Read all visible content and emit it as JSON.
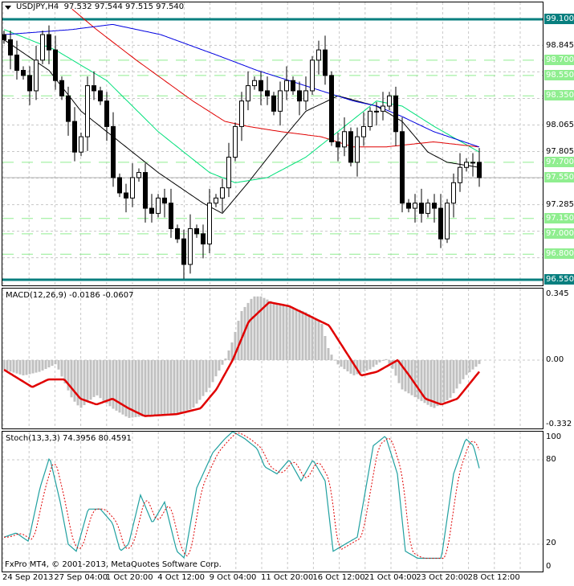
{
  "header": {
    "symbol": "USDJPY,H4",
    "ohlc": "97.532 97.544 97.515 97.540"
  },
  "macd_header": "MACD(12,26,9) -0.0186 -0.0607",
  "stoch_header": "Stoch(13,3,3) 74.3956 80.4591",
  "copyright": "FxPro MT4, © 2001-2013, MetaQuotes Software Corp.",
  "colors": {
    "teal": "#087f7f",
    "level_green": "#90ee90",
    "ma_fast": "#000000",
    "ma_green": "#00e07a",
    "ma_red": "#e00000",
    "ma_blue": "#0000e0",
    "macd_hist": "#c0c0c0",
    "macd_signal": "#e00000",
    "stoch_main": "#20a0a0",
    "stoch_signal": "#e00000"
  },
  "price_axis": {
    "grid_labels": [
      "98.845",
      "98.065",
      "97.805",
      "97.285"
    ],
    "teal_levels": [
      "99.100",
      "96.550"
    ],
    "green_levels": [
      "98.700",
      "98.550",
      "98.350",
      "97.700",
      "97.550",
      "97.150",
      "97.000",
      "96.800"
    ]
  },
  "macd_axis": [
    "0.345",
    "0.00",
    "-0.332"
  ],
  "stoch_axis": [
    "100",
    "80",
    "20",
    "0"
  ],
  "time_axis": [
    "24 Sep 2013",
    "27 Sep 04:00",
    "1 Oct 20:00",
    "4 Oct 12:00",
    "9 Oct 04:00",
    "11 Oct 20:00",
    "16 Oct 12:00",
    "21 Oct 04:00",
    "23 Oct 20:00",
    "28 Oct 12:00"
  ],
  "chart_data": {
    "type": "candlestick",
    "symbol": "USDJPY",
    "timeframe": "H4",
    "price_range": [
      96.505,
      99.13
    ],
    "closes": [
      98.9,
      98.75,
      98.6,
      98.55,
      98.4,
      98.7,
      98.95,
      98.8,
      98.5,
      98.35,
      98.1,
      97.8,
      97.95,
      98.45,
      98.4,
      98.3,
      98.05,
      97.55,
      97.4,
      97.35,
      97.55,
      97.6,
      97.25,
      97.2,
      97.35,
      97.3,
      97.05,
      96.95,
      96.7,
      97.05,
      97.0,
      96.9,
      97.3,
      97.35,
      97.45,
      97.75,
      98.05,
      98.3,
      98.45,
      98.5,
      98.4,
      98.35,
      98.2,
      98.4,
      98.5,
      98.4,
      98.3,
      98.4,
      98.7,
      98.8,
      98.55,
      97.9,
      97.85,
      98.0,
      97.7,
      97.95,
      98.05,
      98.2,
      98.2,
      98.25,
      98.35,
      98.0,
      97.3,
      97.25,
      97.3,
      97.2,
      97.3,
      97.25,
      96.95,
      97.3,
      97.5,
      97.65,
      97.7,
      97.7,
      97.55
    ],
    "moving_averages": {
      "black": [
        [
          0,
          98.9
        ],
        [
          7,
          98.6
        ],
        [
          12,
          98.2
        ],
        [
          18,
          97.9
        ],
        [
          24,
          97.6
        ],
        [
          31,
          97.3
        ],
        [
          34,
          97.2
        ],
        [
          38,
          97.5
        ],
        [
          43,
          97.9
        ],
        [
          47,
          98.2
        ],
        [
          52,
          98.35
        ],
        [
          58,
          98.25
        ],
        [
          62,
          98.1
        ],
        [
          66,
          97.8
        ],
        [
          69,
          97.7
        ],
        [
          74,
          97.65
        ]
      ],
      "green": [
        [
          0,
          99.0
        ],
        [
          8,
          98.8
        ],
        [
          16,
          98.5
        ],
        [
          24,
          98.0
        ],
        [
          32,
          97.6
        ],
        [
          36,
          97.5
        ],
        [
          41,
          97.55
        ],
        [
          47,
          97.75
        ],
        [
          52,
          98.0
        ],
        [
          58,
          98.3
        ],
        [
          62,
          98.25
        ],
        [
          67,
          98.05
        ],
        [
          74,
          97.8
        ]
      ],
      "red": [
        [
          10.6,
          99.2
        ],
        [
          14.4,
          99.0
        ],
        [
          20.6,
          98.7
        ],
        [
          29.4,
          98.3
        ],
        [
          34.4,
          98.1
        ],
        [
          38.1,
          98.05
        ],
        [
          43.1,
          98.0
        ],
        [
          49.4,
          97.95
        ],
        [
          54.4,
          97.85
        ],
        [
          59.4,
          97.85
        ],
        [
          66.9,
          97.9
        ],
        [
          74,
          97.85
        ]
      ],
      "blue": [
        [
          0,
          98.95
        ],
        [
          10.6,
          99.0
        ],
        [
          16.9,
          99.05
        ],
        [
          24.4,
          98.95
        ],
        [
          33.1,
          98.75
        ],
        [
          39.4,
          98.6
        ],
        [
          44.4,
          98.5
        ],
        [
          49.4,
          98.4
        ],
        [
          54.4,
          98.3
        ],
        [
          58.1,
          98.25
        ],
        [
          61.9,
          98.15
        ],
        [
          66.9,
          98.0
        ],
        [
          74,
          97.85
        ]
      ]
    },
    "levels": {
      "teal": [
        99.1,
        96.55
      ],
      "green": [
        98.7,
        98.55,
        98.35,
        97.7,
        97.55,
        97.15,
        97.0,
        96.8
      ],
      "grid": [
        98.845,
        98.585,
        98.325,
        98.065,
        97.805,
        97.545,
        97.285,
        97.025,
        96.765
      ]
    },
    "macd": {
      "range": [
        -0.332,
        0.345
      ],
      "histogram": [
        [
          0,
          -0.05
        ],
        [
          3.1,
          -0.08
        ],
        [
          5.6,
          -0.06
        ],
        [
          8.1,
          -0.02
        ],
        [
          10.6,
          -0.2
        ],
        [
          11.9,
          -0.25
        ],
        [
          14.4,
          -0.18
        ],
        [
          16.9,
          -0.25
        ],
        [
          19.4,
          -0.3
        ],
        [
          24.4,
          -0.28
        ],
        [
          26.9,
          -0.28
        ],
        [
          29.4,
          -0.25
        ],
        [
          31.9,
          -0.15
        ],
        [
          34.4,
          0
        ],
        [
          35.6,
          0.1
        ],
        [
          36.9,
          0.25
        ],
        [
          38.8,
          0.33
        ],
        [
          40,
          0.33
        ],
        [
          41.9,
          0.3
        ],
        [
          44.4,
          0.28
        ],
        [
          46.9,
          0.25
        ],
        [
          49.4,
          0.2
        ],
        [
          50.6,
          0.05
        ],
        [
          51.9,
          -0.02
        ],
        [
          54.4,
          -0.08
        ],
        [
          56.9,
          -0.05
        ],
        [
          59.4,
          0.01
        ],
        [
          60.6,
          -0.05
        ],
        [
          61.9,
          -0.15
        ],
        [
          64.4,
          -0.2
        ],
        [
          66.9,
          -0.25
        ],
        [
          69.4,
          -0.2
        ],
        [
          71.9,
          -0.08
        ],
        [
          74,
          -0.02
        ]
      ],
      "signal": [
        [
          0,
          -0.05
        ],
        [
          4.4,
          -0.14
        ],
        [
          6.9,
          -0.1
        ],
        [
          9.4,
          -0.1
        ],
        [
          11.9,
          -0.2
        ],
        [
          14.4,
          -0.23
        ],
        [
          16.9,
          -0.2
        ],
        [
          19.4,
          -0.25
        ],
        [
          21.9,
          -0.29
        ],
        [
          26.9,
          -0.28
        ],
        [
          30.6,
          -0.25
        ],
        [
          33.1,
          -0.15
        ],
        [
          35.6,
          0
        ],
        [
          38.1,
          0.2
        ],
        [
          41.3,
          0.3
        ],
        [
          44.4,
          0.28
        ],
        [
          48.1,
          0.22
        ],
        [
          50.6,
          0.18
        ],
        [
          53.1,
          0.05
        ],
        [
          55.6,
          -0.08
        ],
        [
          58.1,
          -0.06
        ],
        [
          61.3,
          0
        ],
        [
          63.1,
          -0.08
        ],
        [
          65.6,
          -0.2
        ],
        [
          68.1,
          -0.23
        ],
        [
          70.6,
          -0.2
        ],
        [
          74,
          -0.06
        ]
      ]
    },
    "stochastic": {
      "range": [
        0,
        100
      ],
      "main": [
        [
          0,
          25
        ],
        [
          1.9,
          28
        ],
        [
          3.8,
          22
        ],
        [
          5.6,
          60
        ],
        [
          7.1,
          82
        ],
        [
          8.75,
          50
        ],
        [
          10,
          20
        ],
        [
          11.25,
          15
        ],
        [
          13.1,
          45
        ],
        [
          15,
          45
        ],
        [
          16.9,
          35
        ],
        [
          18.1,
          15
        ],
        [
          19.4,
          20
        ],
        [
          21.25,
          55
        ],
        [
          23.1,
          35
        ],
        [
          25,
          50
        ],
        [
          26.9,
          15
        ],
        [
          28.1,
          10
        ],
        [
          30,
          60
        ],
        [
          32.5,
          85
        ],
        [
          34.4,
          95
        ],
        [
          35.6,
          100
        ],
        [
          37.5,
          95
        ],
        [
          39.4,
          88
        ],
        [
          40.6,
          75
        ],
        [
          42.5,
          70
        ],
        [
          44.4,
          80
        ],
        [
          46.25,
          65
        ],
        [
          48.1,
          80
        ],
        [
          50,
          65
        ],
        [
          51.25,
          15
        ],
        [
          53.1,
          20
        ],
        [
          55,
          25
        ],
        [
          57.5,
          90
        ],
        [
          59.4,
          97
        ],
        [
          61.25,
          70
        ],
        [
          62.5,
          15
        ],
        [
          64.4,
          10
        ],
        [
          66.25,
          10
        ],
        [
          68.1,
          10
        ],
        [
          70,
          70
        ],
        [
          71.9,
          95
        ],
        [
          73.1,
          90
        ],
        [
          74,
          74
        ]
      ]
    }
  }
}
